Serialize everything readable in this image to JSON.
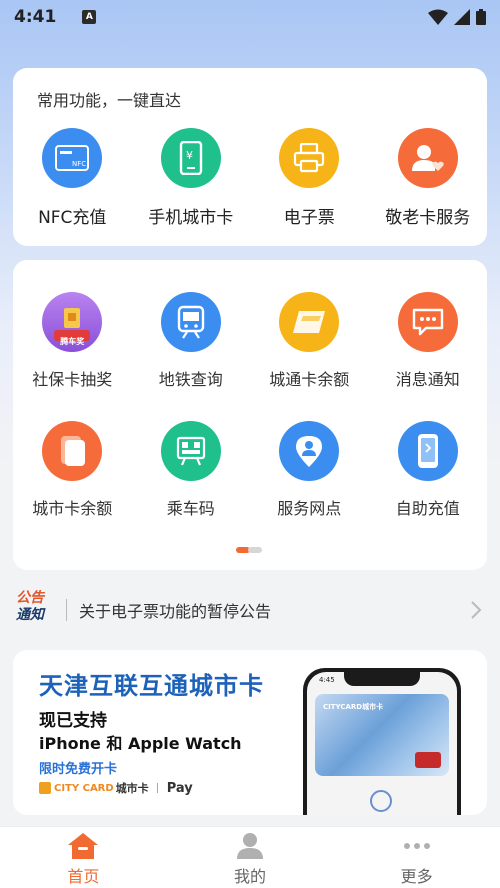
{
  "status_bar": {
    "time": "4:41",
    "notification_badge": "A"
  },
  "quick_access": {
    "title": "常用功能，一键直达",
    "items": [
      {
        "label": "NFC充值",
        "icon": "nfc-card-icon",
        "color": "#3b8ef0"
      },
      {
        "label": "手机城市卡",
        "icon": "phone-card-icon",
        "color": "#1fc08c"
      },
      {
        "label": "电子票",
        "icon": "printer-icon",
        "color": "#f7b418"
      },
      {
        "label": "敬老卡服务",
        "icon": "elder-card-icon",
        "color": "#f56b3a"
      }
    ]
  },
  "services": {
    "items": [
      {
        "label": "社保卡抽奖",
        "icon": "lottery-icon",
        "color": "#9b5ce0",
        "badge": "腾车奖"
      },
      {
        "label": "地铁查询",
        "icon": "metro-icon",
        "color": "#3b8ef0"
      },
      {
        "label": "城通卡余额",
        "icon": "card-balance-icon",
        "color": "#f7b418"
      },
      {
        "label": "消息通知",
        "icon": "message-icon",
        "color": "#f56b3a"
      },
      {
        "label": "城市卡余额",
        "icon": "city-card-icon",
        "color": "#f56b3a"
      },
      {
        "label": "乘车码",
        "icon": "ride-code-icon",
        "color": "#1fc08c"
      },
      {
        "label": "服务网点",
        "icon": "location-icon",
        "color": "#3b8ef0"
      },
      {
        "label": "自助充值",
        "icon": "phone-recharge-icon",
        "color": "#3b8ef0"
      }
    ],
    "page_indicator": {
      "current": 1,
      "total": 2
    }
  },
  "notice": {
    "logo_line1": "公告",
    "logo_line2": "通知",
    "text": "关于电子票功能的暂停公告"
  },
  "banner": {
    "title": "天津互联互通城市卡",
    "line1": "现已支持",
    "line2": "iPhone 和 Apple Watch",
    "line3": "限时免费开卡",
    "brand_en": "CITY CARD",
    "brand_cn": "城市卡",
    "pay": "Pay",
    "phone_time": "4:45",
    "phone_card_title": "CITYCARD城市卡"
  },
  "tabbar": {
    "tabs": [
      {
        "label": "首页",
        "active": true
      },
      {
        "label": "我的",
        "active": false
      },
      {
        "label": "更多",
        "active": false
      }
    ]
  },
  "colors": {
    "accent": "#f06a32",
    "primary_blue": "#1d62b8"
  }
}
